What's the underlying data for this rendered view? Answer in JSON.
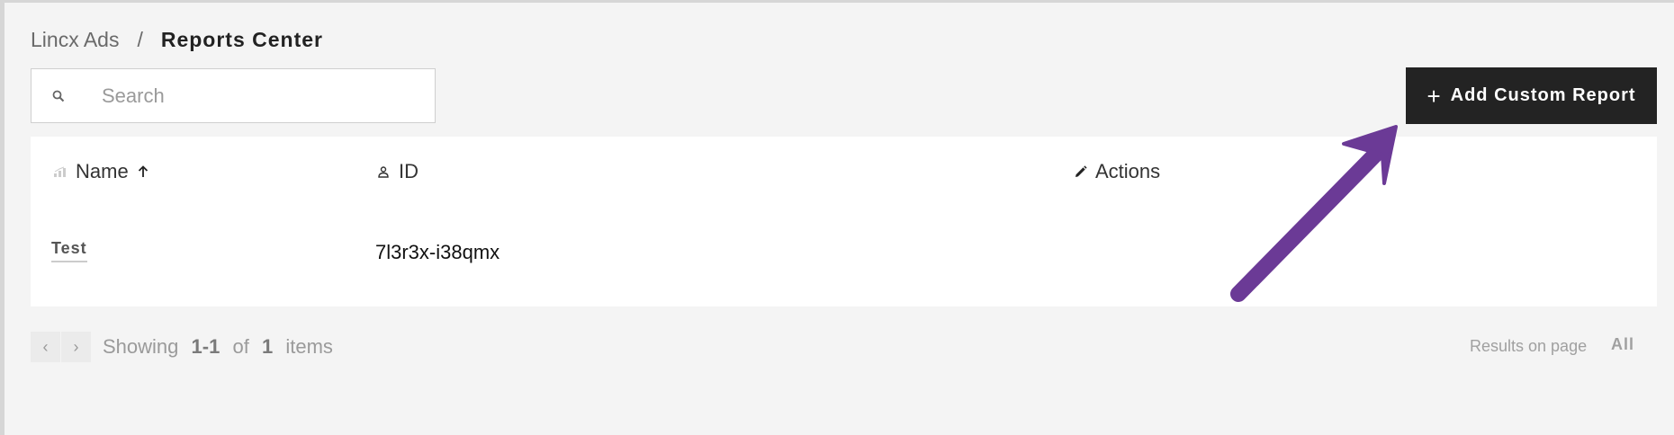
{
  "breadcrumb": {
    "root": "Lincx Ads",
    "separator": "/",
    "current": "Reports Center"
  },
  "search": {
    "placeholder": "Search",
    "value": "",
    "icon": "search-icon"
  },
  "toolbar": {
    "add_label": "Add Custom Report",
    "add_icon": "plus-icon"
  },
  "table": {
    "columns": [
      {
        "label": "Name",
        "icon": "chart-icon",
        "sort": "ascending"
      },
      {
        "label": "ID",
        "icon": "person-icon"
      },
      {
        "label": "Actions",
        "icon": "pencil-icon"
      }
    ],
    "rows": [
      {
        "name": "Test",
        "id": "7l3r3x-i38qmx"
      }
    ]
  },
  "pagination": {
    "showing_word": "Showing",
    "range_start": "1",
    "range_sep": "-",
    "range_end": "1",
    "of_word": "of",
    "total": "1",
    "items_word": "items",
    "results_label": "Results on page",
    "results_value": "All"
  },
  "colors": {
    "background": "#f4f4f4",
    "button": "#232323",
    "annotation_arrow": "#6b3a96"
  }
}
